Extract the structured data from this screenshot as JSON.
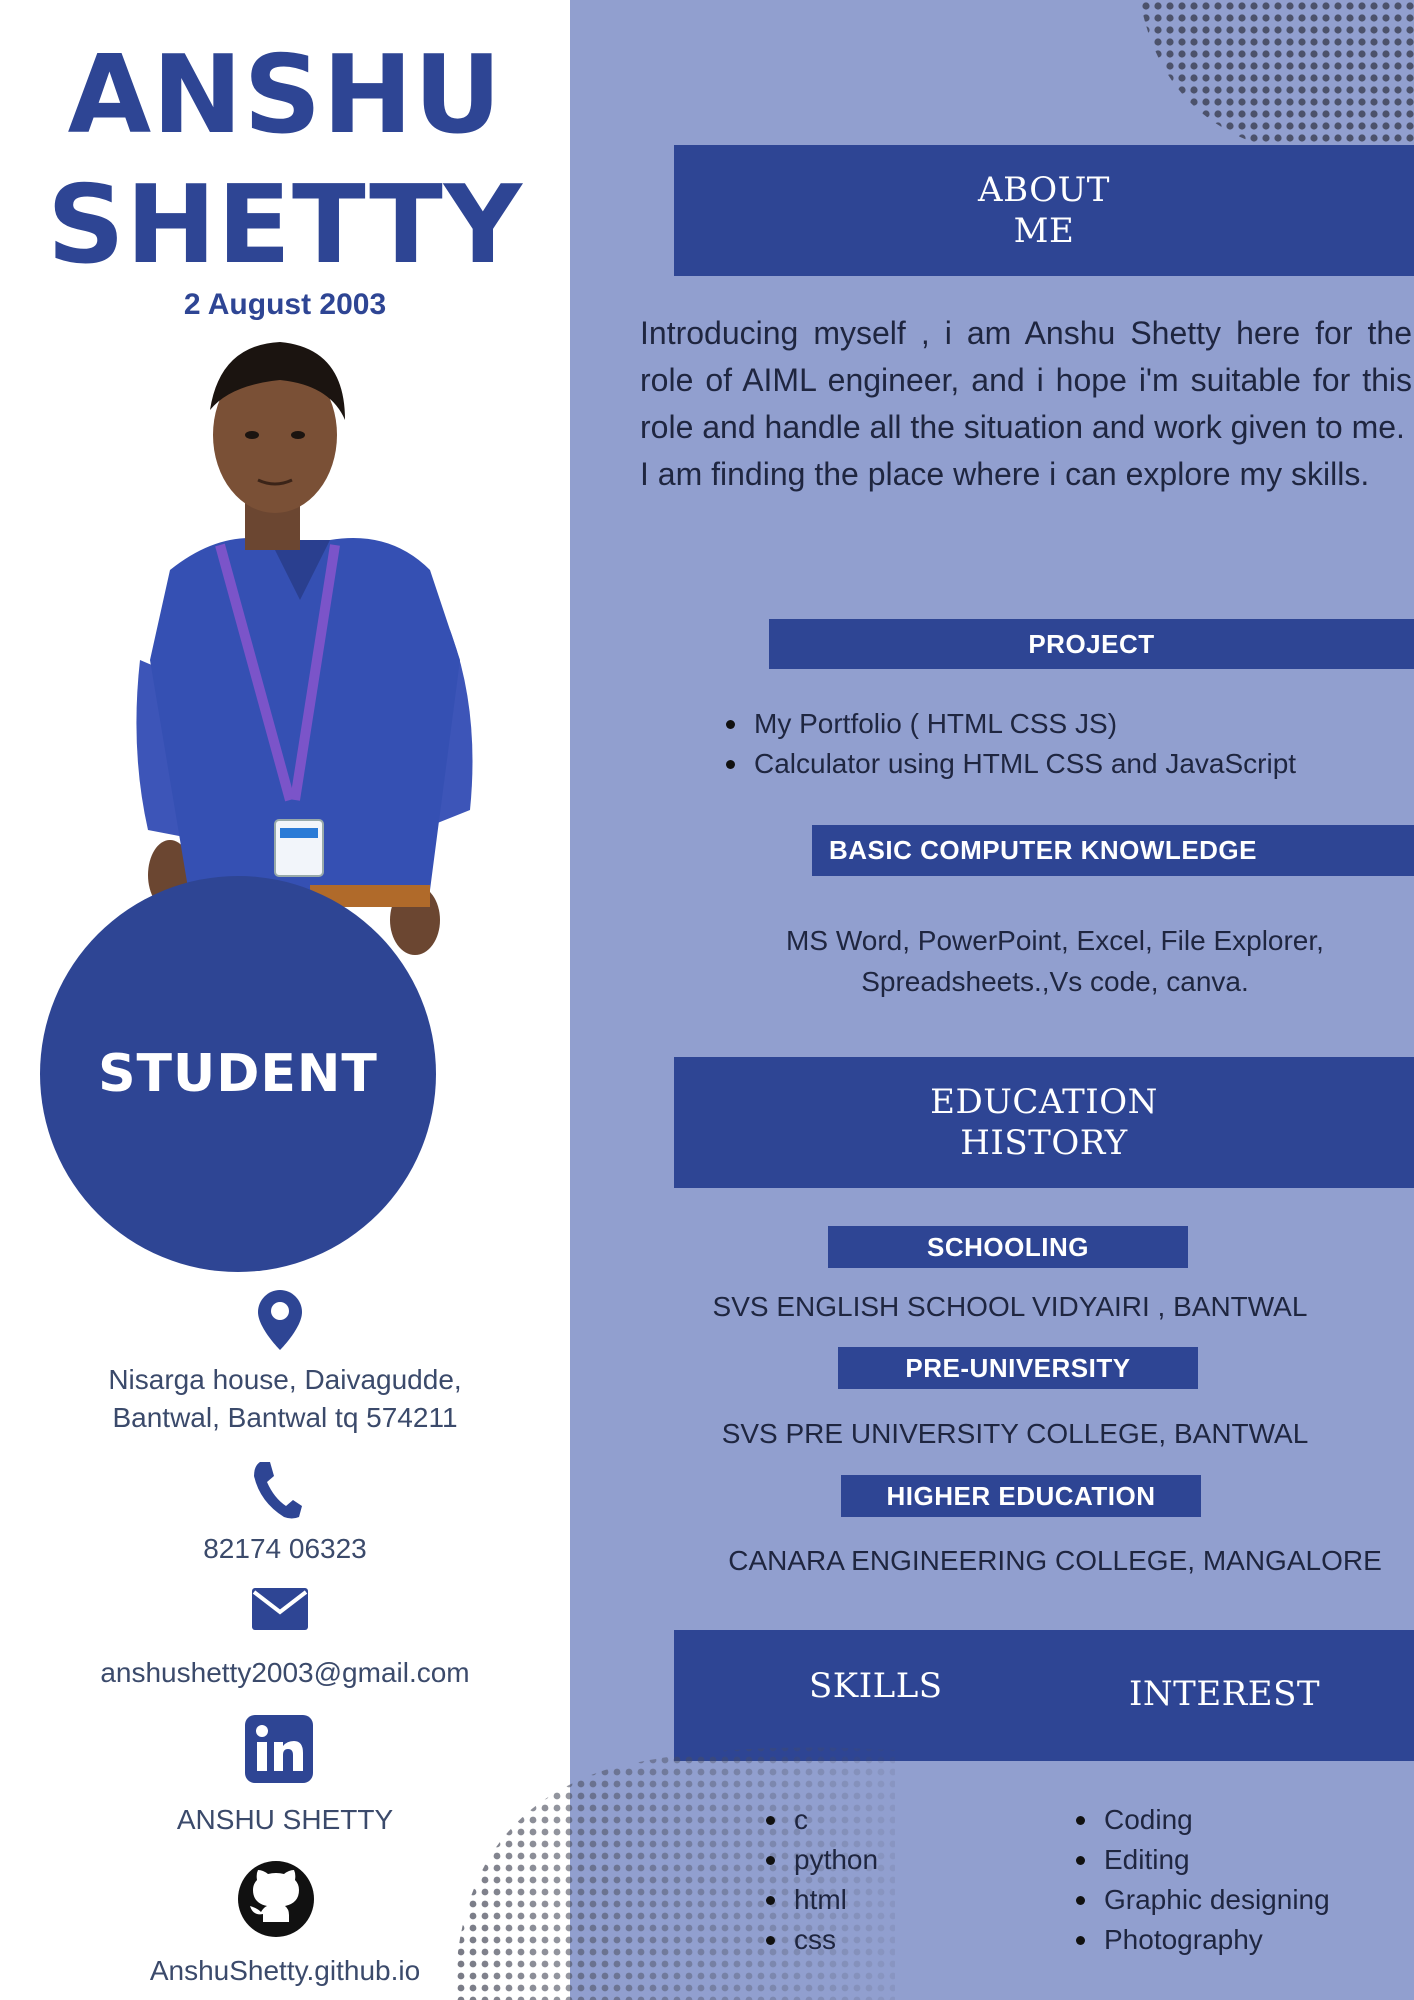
{
  "header": {
    "first_name": "ANSHU",
    "last_name": "SHETTY",
    "dob": "2 August 2003"
  },
  "role_badge": "STUDENT",
  "contact": {
    "address_line1": "Nisarga house, Daivagudde,",
    "address_line2": "Bantwal, Bantwal tq 574211",
    "phone": "82174 06323",
    "email": "anshushetty2003@gmail.com",
    "linkedin": "ANSHU SHETTY",
    "github": "AnshuShetty.github.io",
    "icons": [
      "location-pin-icon",
      "phone-icon",
      "envelope-icon",
      "linkedin-icon",
      "github-icon"
    ]
  },
  "about": {
    "heading_line1": "ABOUT",
    "heading_line2": "ME",
    "paragraph1": "Introducing myself , i am Anshu Shetty here for the role of AIML engineer, and i hope i'm suitable for this role and handle all the situation and work given to me.",
    "paragraph2": "I am finding the place where i can explore my skills."
  },
  "project": {
    "heading": "PROJECT",
    "items": [
      "My  Portfolio ( HTML CSS  JS)",
      "Calculator using HTML CSS and JavaScript"
    ]
  },
  "computer_knowledge": {
    "heading": "BASIC COMPUTER KNOWLEDGE",
    "line1": "MS Word, PowerPoint, Excel, File Explorer,",
    "line2": "Spreadsheets.,Vs code, canva."
  },
  "education": {
    "heading_line1": "EDUCATION",
    "heading_line2": "HISTORY",
    "schooling_label": "SCHOOLING",
    "schooling_value": "SVS ENGLISH SCHOOL VIDYAIRI , BANTWAL",
    "pu_label": "PRE-UNIVERSITY",
    "pu_value": "SVS PRE UNIVERSITY COLLEGE, BANTWAL",
    "higher_label": "HIGHER EDUCATION",
    "higher_value": "CANARA ENGINEERING COLLEGE, MANGALORE"
  },
  "skills": {
    "heading": "SKILLS",
    "items": [
      "c",
      "python",
      "html",
      "css"
    ]
  },
  "interest": {
    "heading": "INTEREST",
    "items": [
      "Coding",
      "Editing",
      "Graphic designing",
      "Photography"
    ]
  },
  "colors": {
    "primary": "#2e4594",
    "panel": "#919fcf",
    "text": "#1f2640"
  }
}
